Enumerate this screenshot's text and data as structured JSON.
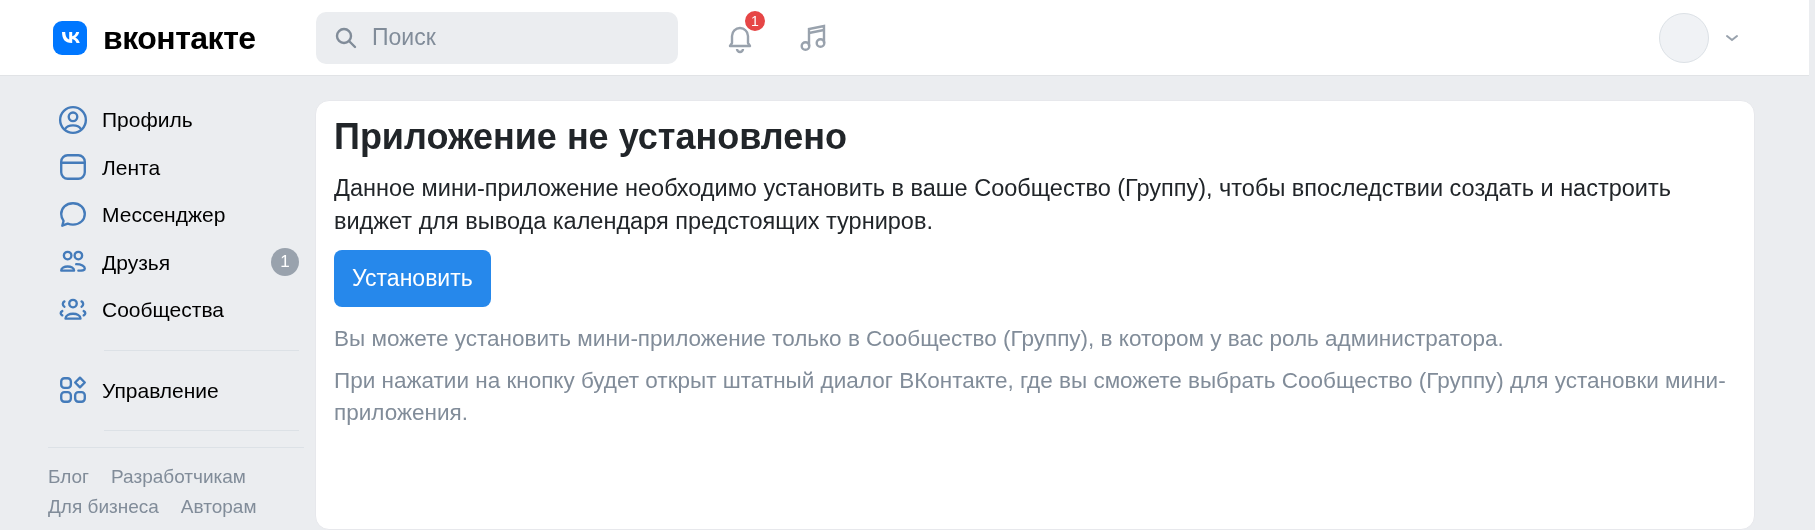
{
  "header": {
    "logo_text": "вконтакте",
    "search": {
      "placeholder": "Поиск"
    },
    "notifications_badge": "1"
  },
  "sidebar": {
    "items": [
      {
        "kind": "profile",
        "label": "Профиль"
      },
      {
        "kind": "feed",
        "label": "Лента"
      },
      {
        "kind": "messenger",
        "label": "Мессенджер"
      },
      {
        "kind": "friends",
        "label": "Друзья",
        "badge": "1"
      },
      {
        "kind": "communities",
        "label": "Сообщества"
      }
    ],
    "manage_items": [
      {
        "kind": "manage",
        "label": "Управление"
      }
    ],
    "footer_links": [
      "Блог",
      "Разработчикам",
      "Для бизнеса",
      "Авторам"
    ]
  },
  "content": {
    "title": "Приложение не установлено",
    "description": "Данное мини-приложение необходимо установить в ваше Сообщество (Группу), чтобы впоследствии создать и настроить виджет для вывода календаря предстоящих турниров.",
    "button": "Установить",
    "notes": [
      "Вы можете установить мини-приложение только в Сообщество (Группу), в котором у вас роль администратора.",
      "При нажатии на кнопку будет открыт штатный диалог ВКонтакте, где вы сможете выбрать Сообщество (Группу) для установки мини-приложения."
    ]
  }
}
